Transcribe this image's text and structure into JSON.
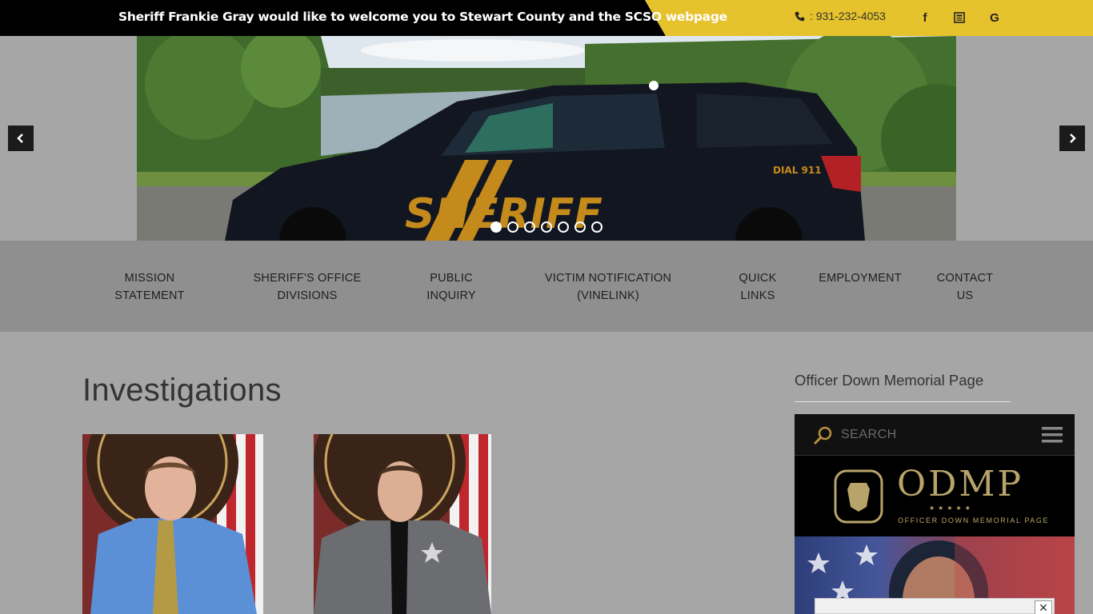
{
  "topbar": {
    "welcome": "Sheriff Frankie Gray would like to welcome you to Stewart County and the SCSO webpage",
    "phone": ": 931-232-4053",
    "social": [
      {
        "icon": "facebook-icon",
        "glyph": "f"
      },
      {
        "icon": "news-icon",
        "glyph": "▤"
      },
      {
        "icon": "google-icon",
        "glyph": "G"
      }
    ],
    "black_color": "#000000",
    "yellow_color": "#e6c22c"
  },
  "slider": {
    "prev_icon": "chevron-left-icon",
    "next_icon": "chevron-right-icon",
    "dot_count": 7,
    "active_dot": 0,
    "vehicle_text": "SHERIFF",
    "vehicle_badge": "DIAL 911"
  },
  "nav": {
    "items": [
      {
        "label": "MISSION\nSTATEMENT"
      },
      {
        "label": "SHERIFF'S OFFICE\nDIVISIONS"
      },
      {
        "label": "PUBLIC\nINQUIRY"
      },
      {
        "label": "VICTIM NOTIFICATION\n(VINELINK)"
      },
      {
        "label": "QUICK\nLINKS"
      },
      {
        "label": "EMPLOYMENT"
      },
      {
        "label": "CONTACT\nUS"
      }
    ]
  },
  "main": {
    "title": "Investigations"
  },
  "sidebar": {
    "title": "Officer Down Memorial Page",
    "odmp": {
      "search_placeholder": "SEARCH",
      "logo": "ODMP",
      "stars": "★★★★★",
      "subtitle": "OFFICER DOWN MEMORIAL PAGE"
    }
  },
  "popup": {
    "close": "✕"
  }
}
